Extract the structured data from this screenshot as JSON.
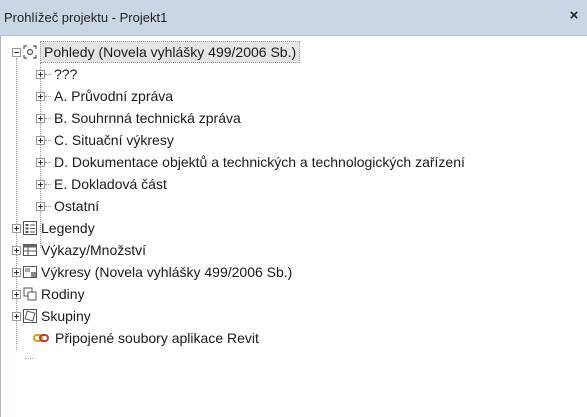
{
  "window": {
    "title": "Prohlížeč projektu - Projekt1",
    "close_glyph": "×"
  },
  "tree": {
    "root": {
      "label": "Pohledy (Novela vyhlášky 499/2006 Sb.)",
      "icon": "views-icon"
    },
    "children": [
      {
        "label": "???"
      },
      {
        "label": "A. Průvodní zpráva"
      },
      {
        "label": "B. Souhrnná technická zpráva"
      },
      {
        "label": "C. Situační výkresy"
      },
      {
        "label": "D. Dokumentace objektů a technických a technologických zařízení"
      },
      {
        "label": "E. Dokladová část"
      },
      {
        "label": "Ostatní"
      }
    ],
    "top_items": [
      {
        "label": "Legendy",
        "icon": "legend-icon"
      },
      {
        "label": "Výkazy/Množství",
        "icon": "schedule-icon"
      },
      {
        "label": "Výkresy (Novela vyhlášky 499/2006 Sb.)",
        "icon": "sheets-icon"
      },
      {
        "label": "Rodiny",
        "icon": "families-icon"
      },
      {
        "label": "Skupiny",
        "icon": "groups-icon"
      },
      {
        "label": "Připojené soubory aplikace Revit",
        "icon": "revit-links-icon"
      }
    ]
  }
}
